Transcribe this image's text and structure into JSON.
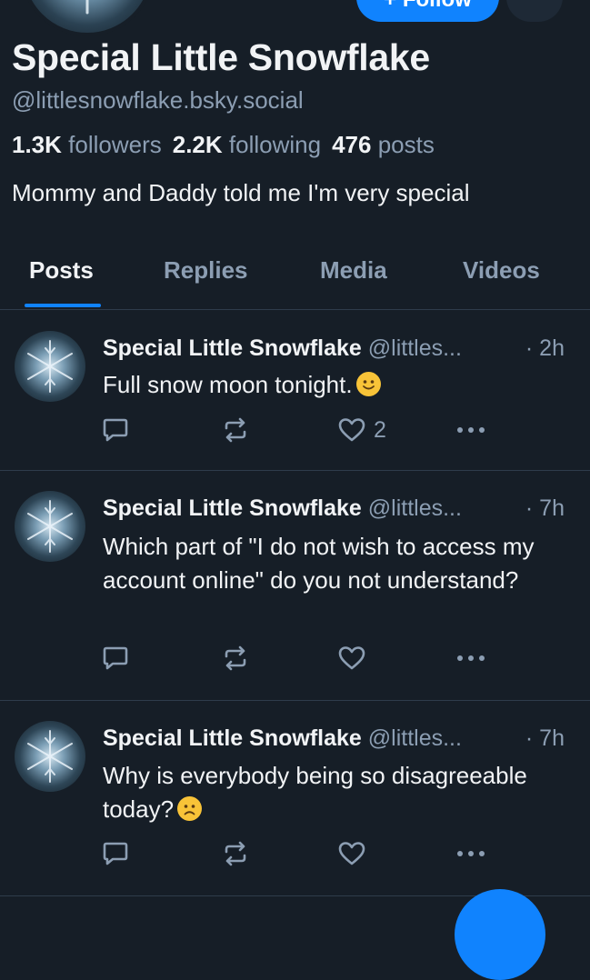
{
  "profile": {
    "display_name": "Special Little Snowflake",
    "handle": "@littlesnowflake.bsky.social",
    "followers_count": "1.3K",
    "followers_label": "followers",
    "following_count": "2.2K",
    "following_label": "following",
    "posts_count": "476",
    "posts_label": "posts",
    "bio": "Mommy and Daddy told me I'm very special",
    "follow_button_label": "+ Follow"
  },
  "tabs": [
    {
      "label": "Posts",
      "active": true
    },
    {
      "label": "Replies",
      "active": false
    },
    {
      "label": "Media",
      "active": false
    },
    {
      "label": "Videos",
      "active": false
    }
  ],
  "posts": [
    {
      "author_name": "Special Little Snowflake",
      "author_handle": "@littles...",
      "time": "· 2h",
      "text": "Full snow moon tonight.",
      "emoji": "slightly-smiling-face",
      "like_count": "2"
    },
    {
      "author_name": "Special Little Snowflake",
      "author_handle": "@littles...",
      "time": "· 7h",
      "text": "Which part of \"I do not wish to access my account online\" do you not understand?",
      "emoji": "",
      "like_count": ""
    },
    {
      "author_name": "Special Little Snowflake",
      "author_handle": "@littles...",
      "time": "· 7h",
      "text": "Why is everybody being so disagreeable today?",
      "emoji": "frowning-face",
      "like_count": ""
    }
  ],
  "icons": {
    "reply": "speech-bubble-icon",
    "repost": "repost-arrows-icon",
    "like": "heart-icon",
    "more": "ellipsis-icon",
    "compose": "compose-fab"
  },
  "colors": {
    "background": "#161e27",
    "accent": "#1083fe",
    "muted_text": "#8c9eb3",
    "divider": "#2e3c4b"
  }
}
